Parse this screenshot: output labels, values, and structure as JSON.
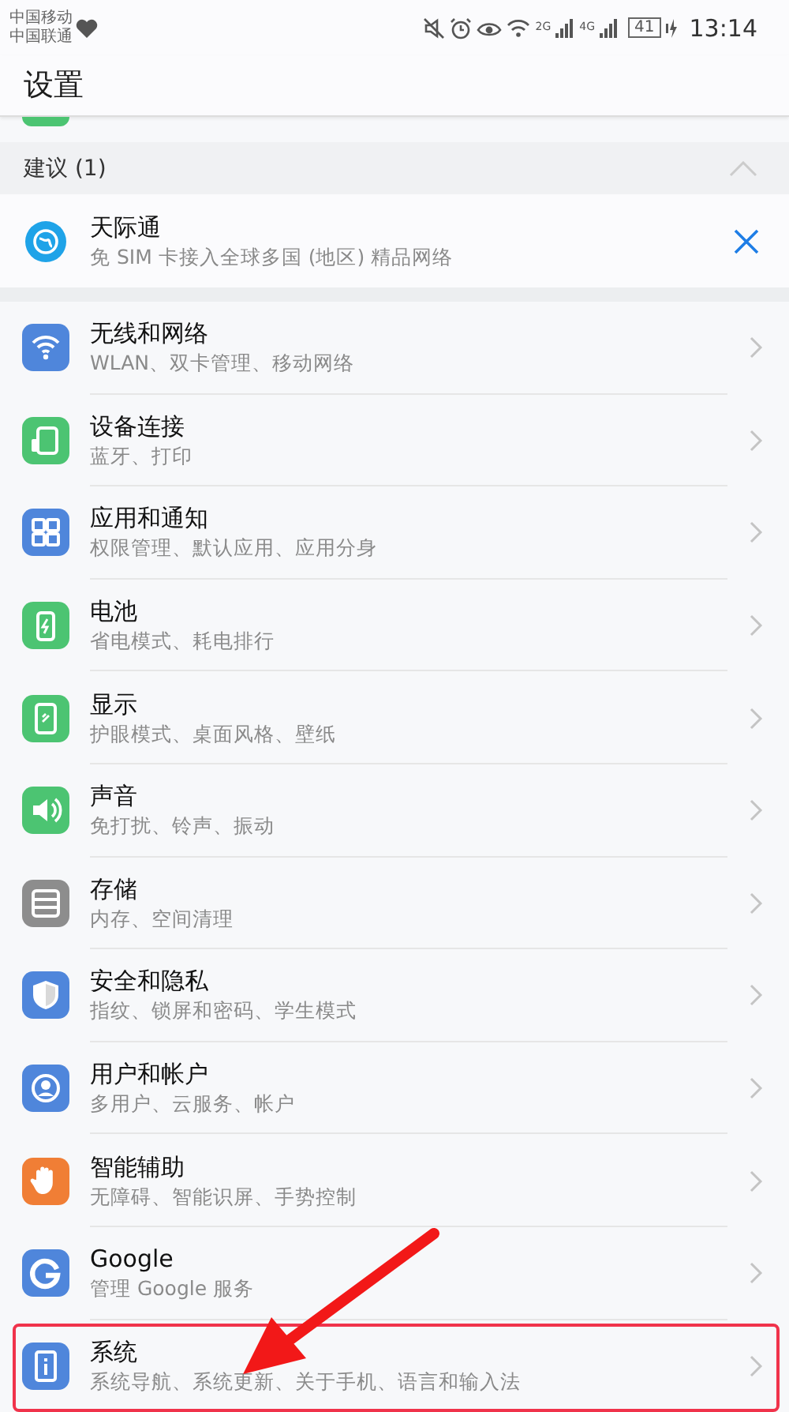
{
  "status_bar": {
    "carriers": [
      "中国移动",
      "中国联通"
    ],
    "network_labels": [
      "2G",
      "4G"
    ],
    "battery": "41",
    "time": "13:14"
  },
  "header": {
    "title": "设置"
  },
  "suggestions": {
    "title": "建议 (1)",
    "expanded": true,
    "items": [
      {
        "title": "天际通",
        "subtitle": "免 SIM 卡接入全球多国 (地区) 精品网络",
        "color": "#1fa3e8"
      }
    ]
  },
  "settings": [
    {
      "title": "无线和网络",
      "subtitle": "WLAN、双卡管理、移动网络",
      "color": "#4f86db",
      "highlighted": false
    },
    {
      "title": "设备连接",
      "subtitle": "蓝牙、打印",
      "color": "#4cc472",
      "highlighted": false
    },
    {
      "title": "应用和通知",
      "subtitle": "权限管理、默认应用、应用分身",
      "color": "#4f86db",
      "highlighted": false
    },
    {
      "title": "电池",
      "subtitle": "省电模式、耗电排行",
      "color": "#4cc472",
      "highlighted": false
    },
    {
      "title": "显示",
      "subtitle": "护眼模式、桌面风格、壁纸",
      "color": "#4cc472",
      "highlighted": false
    },
    {
      "title": "声音",
      "subtitle": "免打扰、铃声、振动",
      "color": "#4cc472",
      "highlighted": false
    },
    {
      "title": "存储",
      "subtitle": "内存、空间清理",
      "color": "#8d8d8d",
      "highlighted": false
    },
    {
      "title": "安全和隐私",
      "subtitle": "指纹、锁屏和密码、学生模式",
      "color": "#4f86db",
      "highlighted": false
    },
    {
      "title": "用户和帐户",
      "subtitle": "多用户、云服务、帐户",
      "color": "#4f86db",
      "highlighted": false
    },
    {
      "title": "智能辅助",
      "subtitle": "无障碍、智能识屏、手势控制",
      "color": "#f07e35",
      "highlighted": false
    },
    {
      "title": "Google",
      "subtitle": "管理 Google 服务",
      "color": "#4f86db",
      "highlighted": false
    },
    {
      "title": "系统",
      "subtitle": "系统导航、系统更新、关于手机、语言和输入法",
      "color": "#4f86db",
      "highlighted": true
    }
  ]
}
